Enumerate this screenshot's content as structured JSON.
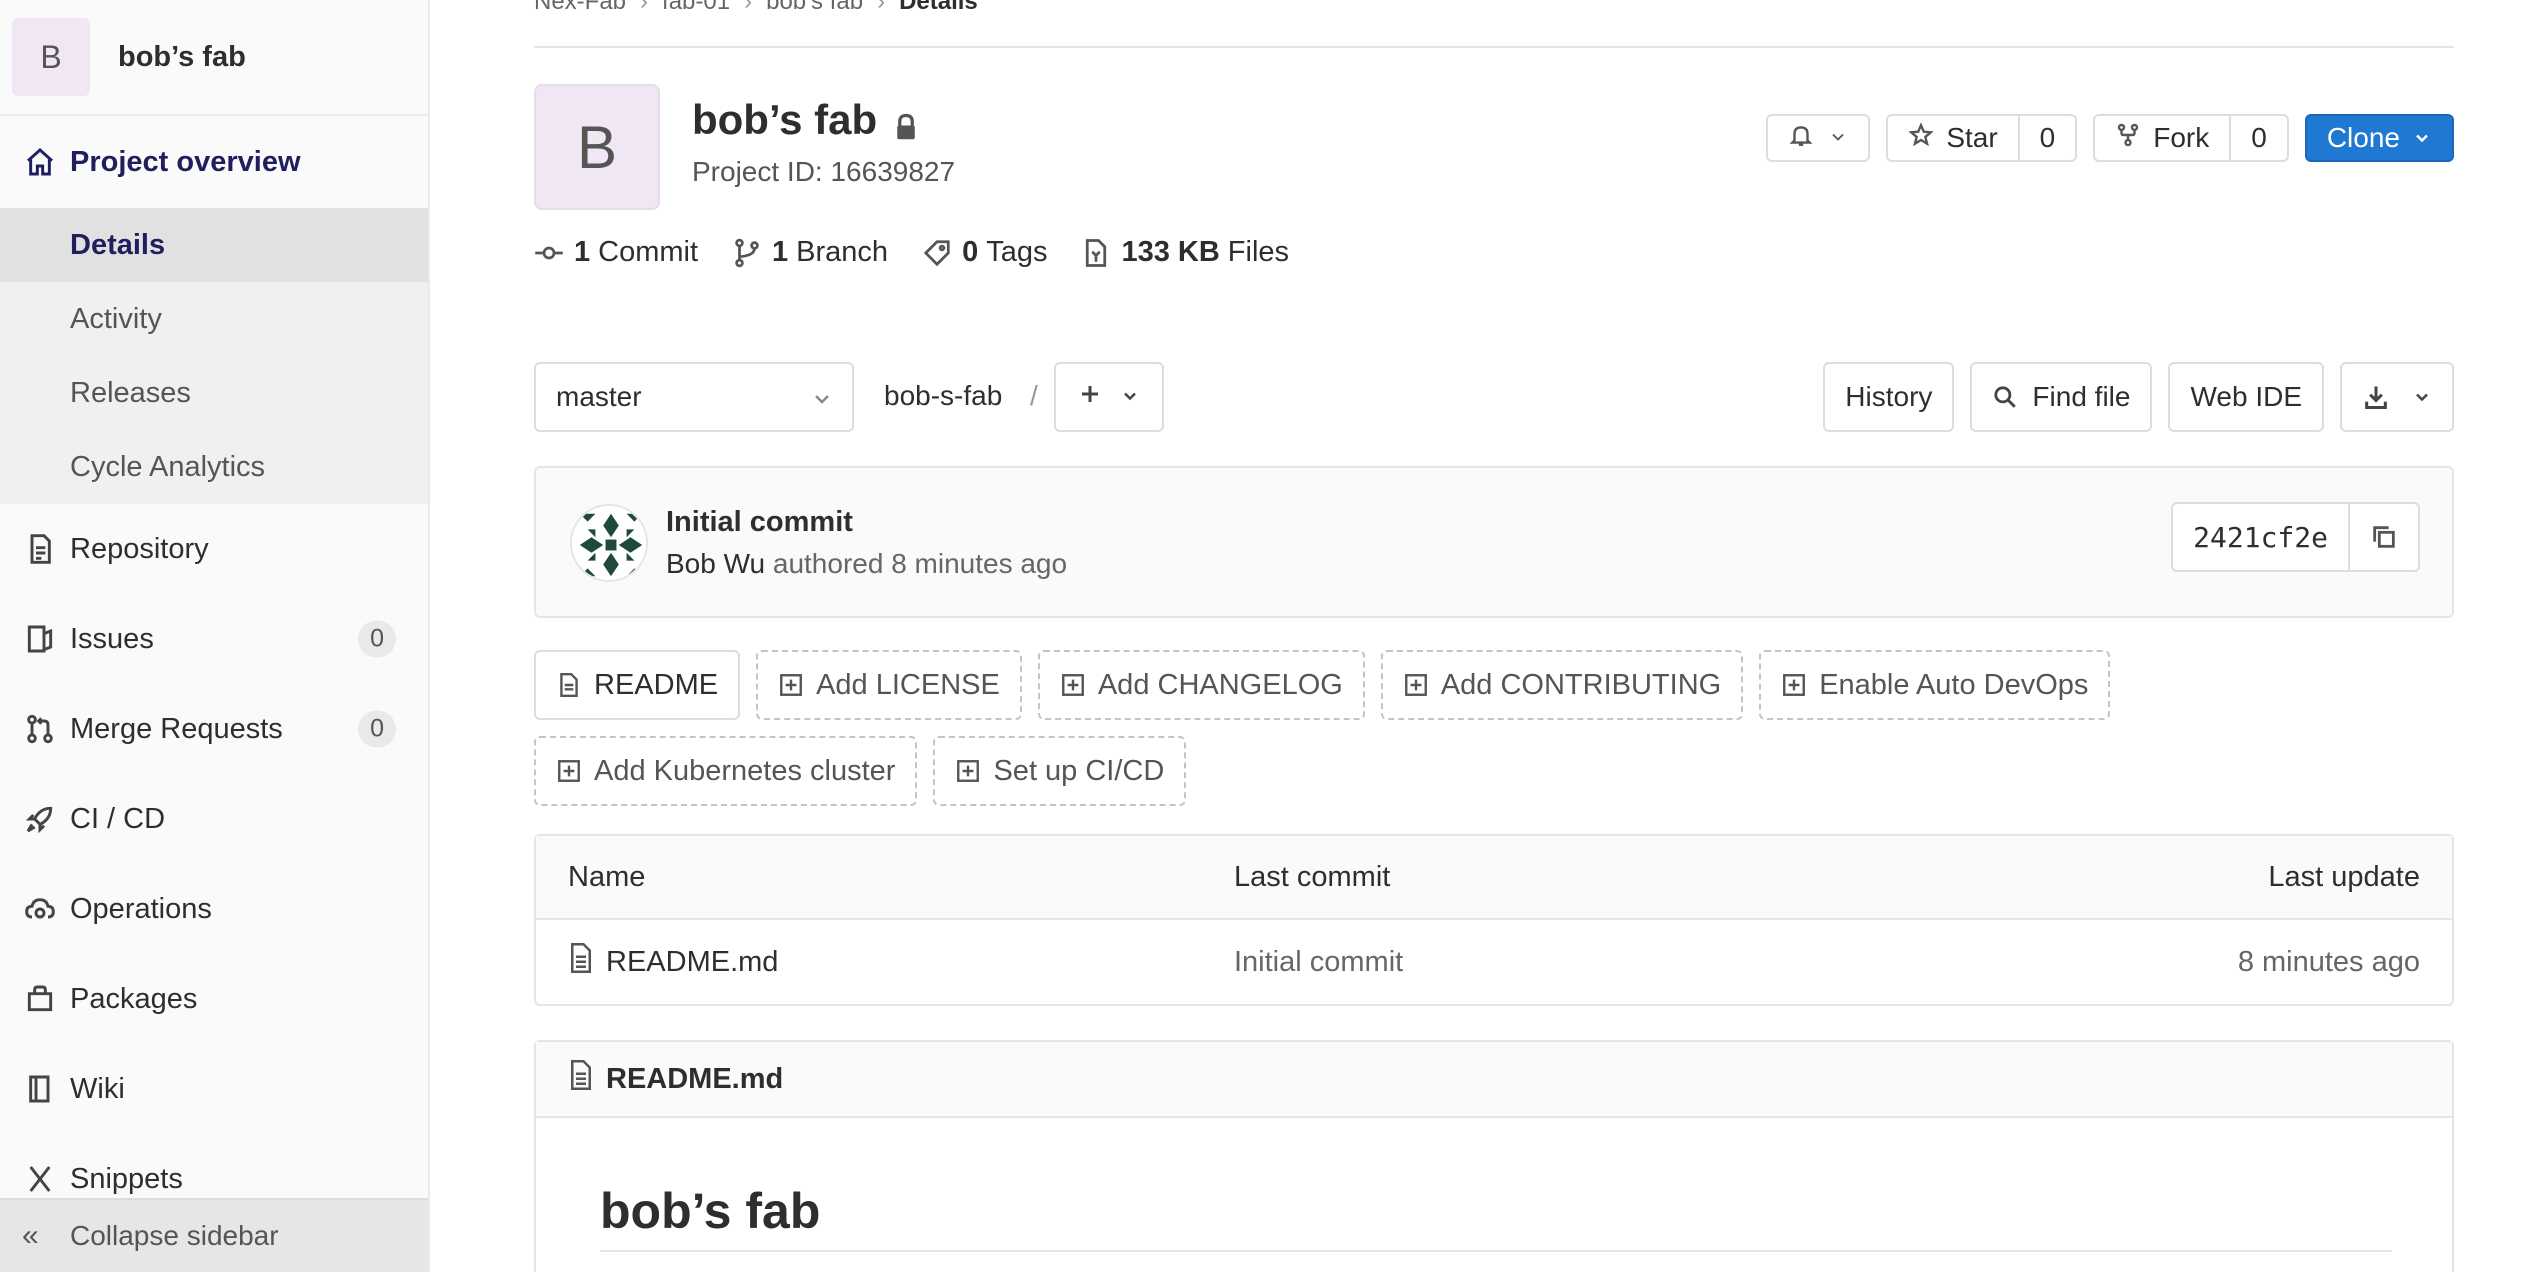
{
  "sidebar": {
    "avatar_letter": "B",
    "project_name": "bob’s fab",
    "overview_label": "Project overview",
    "sub_items": [
      {
        "label": "Details"
      },
      {
        "label": "Activity"
      },
      {
        "label": "Releases"
      },
      {
        "label": "Cycle Analytics"
      }
    ],
    "items": [
      {
        "label": "Repository",
        "icon": "repository-icon"
      },
      {
        "label": "Issues",
        "icon": "issues-icon",
        "count": "0"
      },
      {
        "label": "Merge Requests",
        "icon": "merge-request-icon",
        "count": "0"
      },
      {
        "label": "CI / CD",
        "icon": "rocket-icon"
      },
      {
        "label": "Operations",
        "icon": "cloud-gear-icon"
      },
      {
        "label": "Packages",
        "icon": "package-icon"
      },
      {
        "label": "Wiki",
        "icon": "book-icon"
      },
      {
        "label": "Snippets",
        "icon": "snippet-icon"
      }
    ],
    "collapse_label": "Collapse sidebar"
  },
  "breadcrumb": [
    "Nex-Fab",
    "fab-01",
    "bob’s fab",
    "Details"
  ],
  "project": {
    "avatar_letter": "B",
    "title": "bob’s fab",
    "id_text": "Project ID: 16639827"
  },
  "actions": {
    "star_label": "Star",
    "star_count": "0",
    "fork_label": "Fork",
    "fork_count": "0",
    "clone_label": "Clone"
  },
  "stats": {
    "commits_num": "1",
    "commits_label": "Commit",
    "branches_num": "1",
    "branches_label": "Branch",
    "tags_num": "0",
    "tags_label": "Tags",
    "files_num": "133 KB",
    "files_label": "Files"
  },
  "tree": {
    "branch": "master",
    "path": "bob-s-fab",
    "sep": "/",
    "history_label": "History",
    "find_file_label": "Find file",
    "web_ide_label": "Web IDE"
  },
  "commit": {
    "title": "Initial commit",
    "author": "Bob Wu",
    "meta": "authored 8 minutes ago",
    "sha": "2421cf2e"
  },
  "quick_links": [
    {
      "label": "README",
      "solid": true
    },
    {
      "label": "Add LICENSE"
    },
    {
      "label": "Add CHANGELOG"
    },
    {
      "label": "Add CONTRIBUTING"
    },
    {
      "label": "Enable Auto DevOps"
    },
    {
      "label": "Add Kubernetes cluster"
    },
    {
      "label": "Set up CI/CD"
    }
  ],
  "file_table": {
    "headers": {
      "name": "Name",
      "commit": "Last commit",
      "update": "Last update"
    },
    "rows": [
      {
        "name": "README.md",
        "commit": "Initial commit",
        "update": "8 minutes ago"
      }
    ]
  },
  "readme": {
    "filename": "README.md",
    "heading": "bob’s fab"
  },
  "colors": {
    "accent": "#1f78d1",
    "nav_active": "#1f1f60",
    "avatar_bg": "#f1e6f4"
  }
}
